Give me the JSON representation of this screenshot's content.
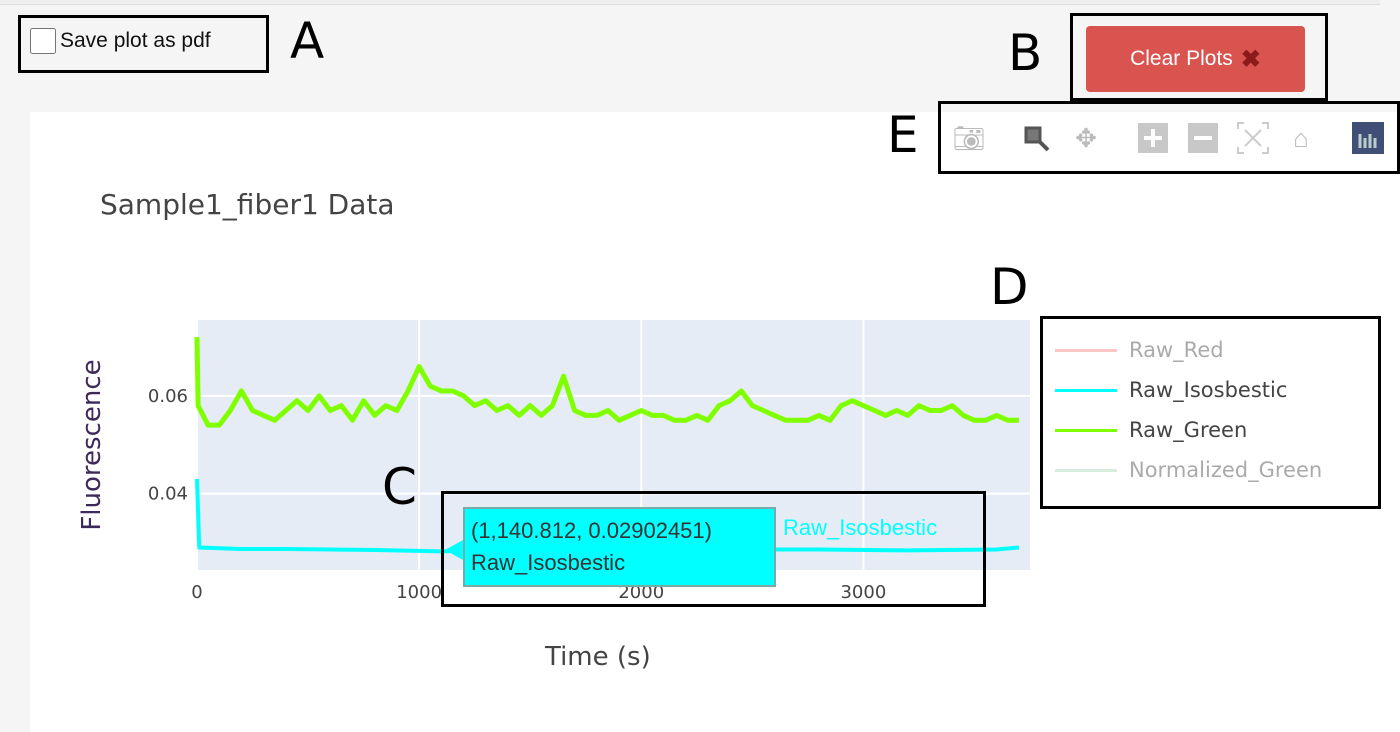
{
  "controls": {
    "save_pdf_label": "Save plot as pdf",
    "save_pdf_checked": false,
    "clear_label": "Clear Plots",
    "clear_icon": "cross-icon",
    "clear_color": "#d9534f"
  },
  "annotations": {
    "a": "A",
    "b": "B",
    "c": "C",
    "d": "D",
    "e": "E"
  },
  "toolbar": [
    "camera-icon",
    "zoom-icon",
    "pan-icon",
    "zoom-in-icon",
    "zoom-out-icon",
    "autoscale-icon",
    "reset-axes-icon",
    "plotly-logo-icon"
  ],
  "tooltip": {
    "value": "(1,140.812, 0.02902451)",
    "series": "Raw_Isosbestic",
    "label": "Raw_Isosbestic"
  },
  "chart_data": {
    "type": "line",
    "title": "Sample1_fiber1 Data",
    "xlabel": "Time (s)",
    "ylabel": "Fluorescence",
    "xlim": [
      0,
      3750
    ],
    "ylim": [
      0.0244,
      0.0755
    ],
    "xticks": [
      "0",
      "1000",
      "2000",
      "3000"
    ],
    "xtick_values": [
      0,
      1000,
      2000,
      3000
    ],
    "yticks": [
      "0.04",
      "0.06"
    ],
    "ytick_values": [
      0.04,
      0.06
    ],
    "grid": true,
    "legend_placement": "right",
    "series": [
      {
        "name": "Raw_Red",
        "color": "#ff7f7f",
        "visible": false,
        "x": [],
        "y": []
      },
      {
        "name": "Raw_Isosbestic",
        "color": "#00ffff",
        "visible": true,
        "x": [
          0,
          10,
          200,
          400,
          600,
          800,
          1000,
          1100,
          1300,
          1600,
          2000,
          2400,
          2800,
          3200,
          3600,
          3700
        ],
        "y": [
          0.043,
          0.029,
          0.0287,
          0.0287,
          0.0286,
          0.0285,
          0.0283,
          0.0282,
          0.0285,
          0.0285,
          0.0285,
          0.0286,
          0.0286,
          0.0284,
          0.0286,
          0.029
        ]
      },
      {
        "name": "Raw_Green",
        "color": "#7fff00",
        "visible": true,
        "x": [
          0,
          5,
          50,
          100,
          150,
          200,
          250,
          300,
          350,
          400,
          450,
          500,
          550,
          600,
          650,
          700,
          750,
          800,
          850,
          900,
          950,
          1000,
          1050,
          1100,
          1150,
          1200,
          1250,
          1300,
          1350,
          1400,
          1450,
          1500,
          1550,
          1600,
          1650,
          1700,
          1750,
          1800,
          1850,
          1900,
          1950,
          2000,
          2050,
          2100,
          2150,
          2200,
          2250,
          2300,
          2350,
          2400,
          2450,
          2500,
          2550,
          2600,
          2650,
          2700,
          2750,
          2800,
          2850,
          2900,
          2950,
          3000,
          3050,
          3100,
          3150,
          3200,
          3250,
          3300,
          3350,
          3400,
          3450,
          3500,
          3550,
          3600,
          3650,
          3700
        ],
        "y": [
          0.072,
          0.058,
          0.054,
          0.054,
          0.057,
          0.061,
          0.057,
          0.056,
          0.055,
          0.057,
          0.059,
          0.057,
          0.06,
          0.057,
          0.058,
          0.055,
          0.059,
          0.056,
          0.058,
          0.057,
          0.061,
          0.066,
          0.062,
          0.061,
          0.061,
          0.06,
          0.058,
          0.059,
          0.057,
          0.058,
          0.056,
          0.058,
          0.056,
          0.058,
          0.064,
          0.057,
          0.056,
          0.056,
          0.057,
          0.055,
          0.056,
          0.057,
          0.056,
          0.056,
          0.055,
          0.055,
          0.056,
          0.055,
          0.058,
          0.059,
          0.061,
          0.058,
          0.057,
          0.056,
          0.055,
          0.055,
          0.055,
          0.056,
          0.055,
          0.058,
          0.059,
          0.058,
          0.057,
          0.056,
          0.057,
          0.056,
          0.058,
          0.057,
          0.057,
          0.058,
          0.056,
          0.055,
          0.055,
          0.056,
          0.055,
          0.055
        ]
      },
      {
        "name": "Normalized_Green",
        "color": "#a8dab5",
        "visible": false,
        "x": [],
        "y": []
      }
    ]
  }
}
